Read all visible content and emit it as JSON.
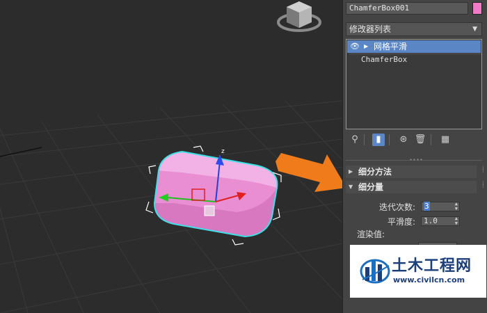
{
  "panel": {
    "object_name": "ChamferBox001",
    "object_color": "#f07ac8",
    "modifier_list_label": "修改器列表",
    "stack": [
      {
        "label": "网格平滑",
        "selected": true
      },
      {
        "label": "ChamferBox",
        "selected": false
      }
    ],
    "rollouts": {
      "subdivision_method": "细分方法",
      "subdivision_amount": "细分量"
    },
    "params": {
      "iterations_label": "迭代次数:",
      "iterations_value": "3",
      "smoothness_label": "平滑度:",
      "smoothness_value": "1.0",
      "render_values_label": "渲染值:"
    }
  },
  "logo": {
    "name": "土木工程网",
    "url": "www.civilcn.com"
  },
  "icons": [
    "view-cube-icon",
    "eye-icon",
    "expand-triangle-icon",
    "pin-stack-icon",
    "show-end-result-icon",
    "make-unique-icon",
    "remove-modifier-icon",
    "configure-modifier-sets-icon",
    "pointer-arrow-icon"
  ],
  "colors": {
    "selection_blue": "#5a86c6",
    "object_pink": "#f07ac8",
    "selection_bracket_cyan": "#3ee0e8",
    "arrow_orange": "#f07b1a"
  }
}
